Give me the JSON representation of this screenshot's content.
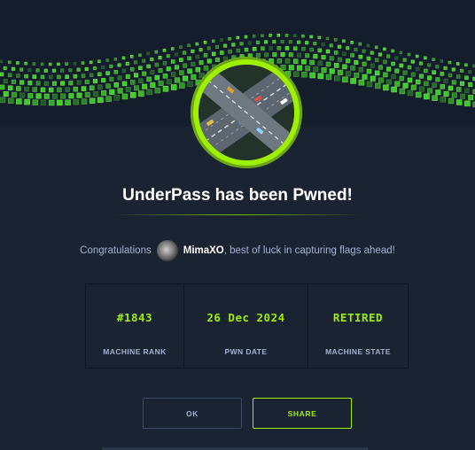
{
  "machine": {
    "name": "UnderPass",
    "logo_icon": "highway-overpass-icon"
  },
  "title": "UnderPass has been Pwned!",
  "congrats": {
    "prefix": "Congratulations",
    "username": "MimaXO",
    "suffix": ", best of luck in capturing flags ahead!"
  },
  "stats": [
    {
      "value": "#1843",
      "label": "MACHINE RANK"
    },
    {
      "value": "26 Dec 2024",
      "label": "PWN DATE"
    },
    {
      "value": "RETIRED",
      "label": "MACHINE STATE"
    }
  ],
  "buttons": {
    "ok_label": "OK",
    "share_label": "SHARE"
  },
  "colors": {
    "background": "#1a2332",
    "accent": "#9fef00",
    "muted_text": "#a4b1cd"
  }
}
